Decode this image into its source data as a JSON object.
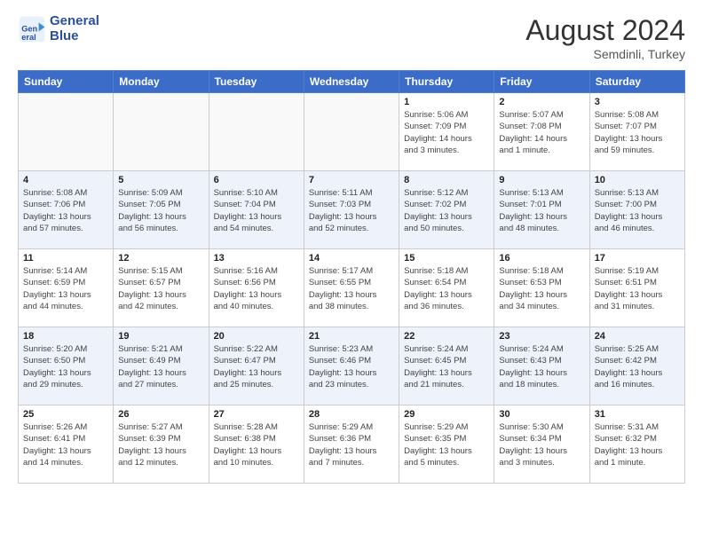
{
  "header": {
    "logo_line1": "General",
    "logo_line2": "Blue",
    "month_year": "August 2024",
    "location": "Semdinli, Turkey"
  },
  "weekdays": [
    "Sunday",
    "Monday",
    "Tuesday",
    "Wednesday",
    "Thursday",
    "Friday",
    "Saturday"
  ],
  "weeks": [
    [
      {
        "day": "",
        "info": ""
      },
      {
        "day": "",
        "info": ""
      },
      {
        "day": "",
        "info": ""
      },
      {
        "day": "",
        "info": ""
      },
      {
        "day": "1",
        "info": "Sunrise: 5:06 AM\nSunset: 7:09 PM\nDaylight: 14 hours\nand 3 minutes."
      },
      {
        "day": "2",
        "info": "Sunrise: 5:07 AM\nSunset: 7:08 PM\nDaylight: 14 hours\nand 1 minute."
      },
      {
        "day": "3",
        "info": "Sunrise: 5:08 AM\nSunset: 7:07 PM\nDaylight: 13 hours\nand 59 minutes."
      }
    ],
    [
      {
        "day": "4",
        "info": "Sunrise: 5:08 AM\nSunset: 7:06 PM\nDaylight: 13 hours\nand 57 minutes."
      },
      {
        "day": "5",
        "info": "Sunrise: 5:09 AM\nSunset: 7:05 PM\nDaylight: 13 hours\nand 56 minutes."
      },
      {
        "day": "6",
        "info": "Sunrise: 5:10 AM\nSunset: 7:04 PM\nDaylight: 13 hours\nand 54 minutes."
      },
      {
        "day": "7",
        "info": "Sunrise: 5:11 AM\nSunset: 7:03 PM\nDaylight: 13 hours\nand 52 minutes."
      },
      {
        "day": "8",
        "info": "Sunrise: 5:12 AM\nSunset: 7:02 PM\nDaylight: 13 hours\nand 50 minutes."
      },
      {
        "day": "9",
        "info": "Sunrise: 5:13 AM\nSunset: 7:01 PM\nDaylight: 13 hours\nand 48 minutes."
      },
      {
        "day": "10",
        "info": "Sunrise: 5:13 AM\nSunset: 7:00 PM\nDaylight: 13 hours\nand 46 minutes."
      }
    ],
    [
      {
        "day": "11",
        "info": "Sunrise: 5:14 AM\nSunset: 6:59 PM\nDaylight: 13 hours\nand 44 minutes."
      },
      {
        "day": "12",
        "info": "Sunrise: 5:15 AM\nSunset: 6:57 PM\nDaylight: 13 hours\nand 42 minutes."
      },
      {
        "day": "13",
        "info": "Sunrise: 5:16 AM\nSunset: 6:56 PM\nDaylight: 13 hours\nand 40 minutes."
      },
      {
        "day": "14",
        "info": "Sunrise: 5:17 AM\nSunset: 6:55 PM\nDaylight: 13 hours\nand 38 minutes."
      },
      {
        "day": "15",
        "info": "Sunrise: 5:18 AM\nSunset: 6:54 PM\nDaylight: 13 hours\nand 36 minutes."
      },
      {
        "day": "16",
        "info": "Sunrise: 5:18 AM\nSunset: 6:53 PM\nDaylight: 13 hours\nand 34 minutes."
      },
      {
        "day": "17",
        "info": "Sunrise: 5:19 AM\nSunset: 6:51 PM\nDaylight: 13 hours\nand 31 minutes."
      }
    ],
    [
      {
        "day": "18",
        "info": "Sunrise: 5:20 AM\nSunset: 6:50 PM\nDaylight: 13 hours\nand 29 minutes."
      },
      {
        "day": "19",
        "info": "Sunrise: 5:21 AM\nSunset: 6:49 PM\nDaylight: 13 hours\nand 27 minutes."
      },
      {
        "day": "20",
        "info": "Sunrise: 5:22 AM\nSunset: 6:47 PM\nDaylight: 13 hours\nand 25 minutes."
      },
      {
        "day": "21",
        "info": "Sunrise: 5:23 AM\nSunset: 6:46 PM\nDaylight: 13 hours\nand 23 minutes."
      },
      {
        "day": "22",
        "info": "Sunrise: 5:24 AM\nSunset: 6:45 PM\nDaylight: 13 hours\nand 21 minutes."
      },
      {
        "day": "23",
        "info": "Sunrise: 5:24 AM\nSunset: 6:43 PM\nDaylight: 13 hours\nand 18 minutes."
      },
      {
        "day": "24",
        "info": "Sunrise: 5:25 AM\nSunset: 6:42 PM\nDaylight: 13 hours\nand 16 minutes."
      }
    ],
    [
      {
        "day": "25",
        "info": "Sunrise: 5:26 AM\nSunset: 6:41 PM\nDaylight: 13 hours\nand 14 minutes."
      },
      {
        "day": "26",
        "info": "Sunrise: 5:27 AM\nSunset: 6:39 PM\nDaylight: 13 hours\nand 12 minutes."
      },
      {
        "day": "27",
        "info": "Sunrise: 5:28 AM\nSunset: 6:38 PM\nDaylight: 13 hours\nand 10 minutes."
      },
      {
        "day": "28",
        "info": "Sunrise: 5:29 AM\nSunset: 6:36 PM\nDaylight: 13 hours\nand 7 minutes."
      },
      {
        "day": "29",
        "info": "Sunrise: 5:29 AM\nSunset: 6:35 PM\nDaylight: 13 hours\nand 5 minutes."
      },
      {
        "day": "30",
        "info": "Sunrise: 5:30 AM\nSunset: 6:34 PM\nDaylight: 13 hours\nand 3 minutes."
      },
      {
        "day": "31",
        "info": "Sunrise: 5:31 AM\nSunset: 6:32 PM\nDaylight: 13 hours\nand 1 minute."
      }
    ]
  ]
}
